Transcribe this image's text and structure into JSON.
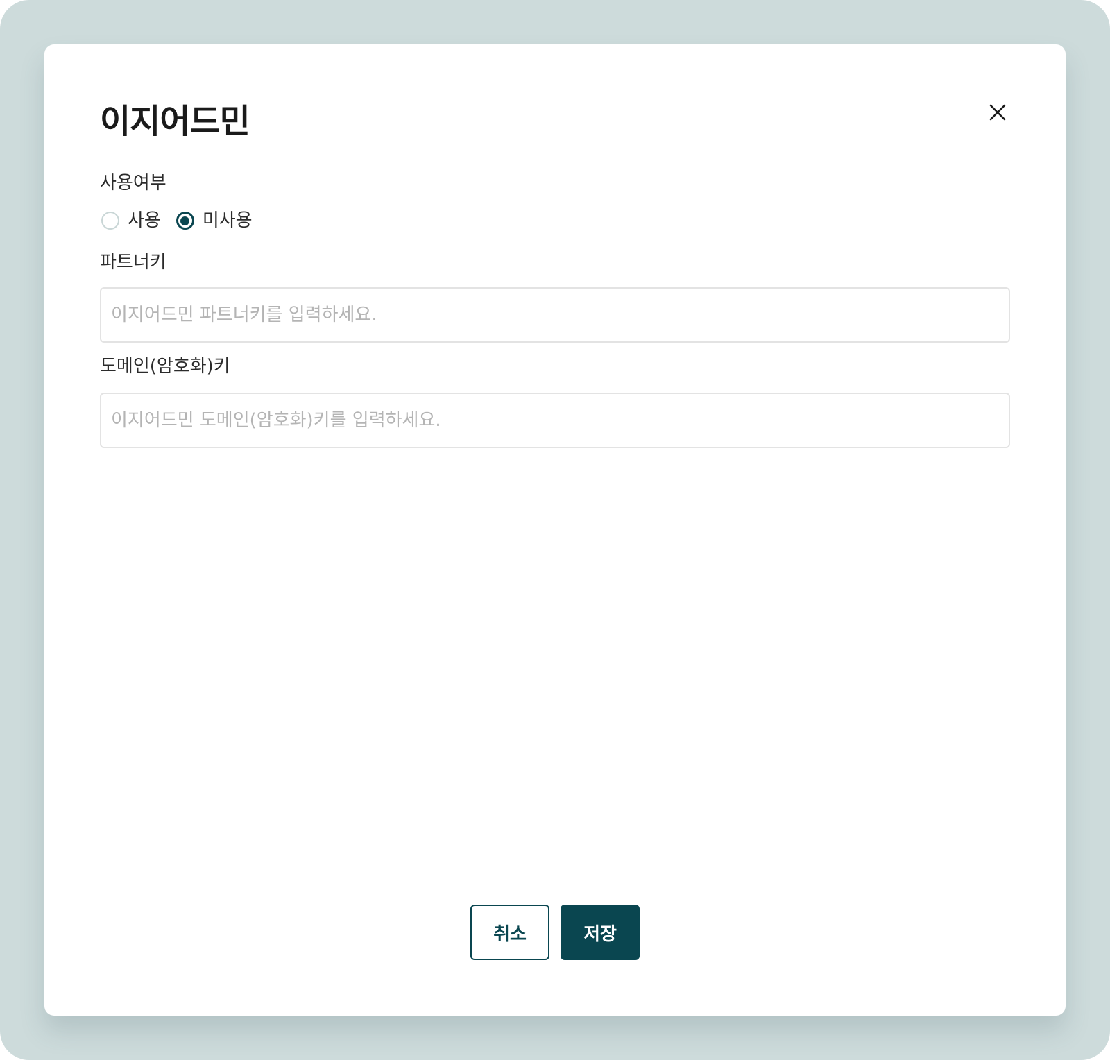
{
  "modal": {
    "title": "이지어드민",
    "close_icon": "close-icon"
  },
  "usage": {
    "label": "사용여부",
    "options": [
      {
        "label": "사용",
        "checked": false
      },
      {
        "label": "미사용",
        "checked": true
      }
    ]
  },
  "partner_key": {
    "label": "파트너키",
    "value": "",
    "placeholder": "이지어드민 파트너키를 입력하세요."
  },
  "domain_key": {
    "label": "도메인(암호화)키",
    "value": "",
    "placeholder": "이지어드민 도메인(암호화)키를 입력하세요."
  },
  "footer": {
    "cancel_label": "취소",
    "save_label": "저장"
  },
  "colors": {
    "backdrop": "#cddbdb",
    "primary": "#0a4650",
    "input_border": "#e3e3e3",
    "placeholder": "#b4b4b4"
  }
}
